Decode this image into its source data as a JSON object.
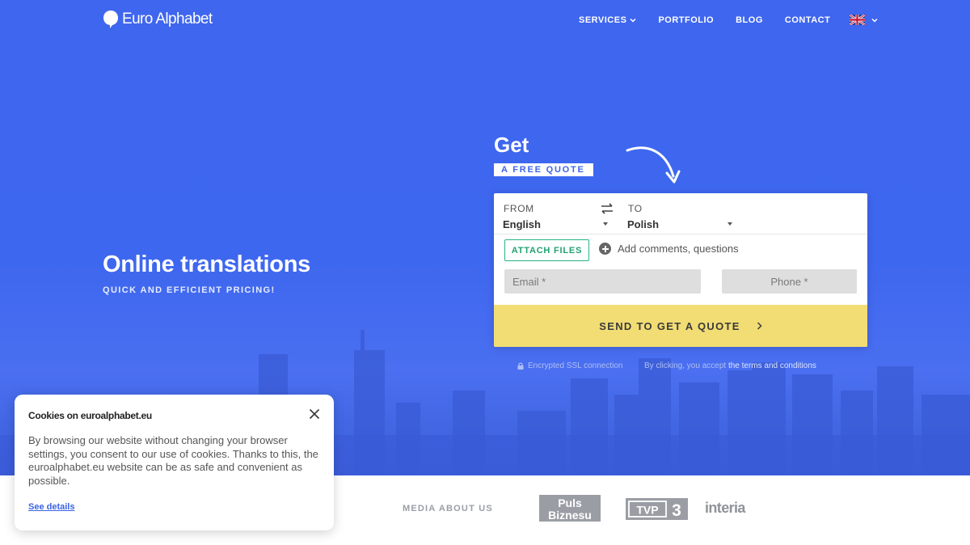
{
  "header": {
    "logo_text": "Euro Alphabet",
    "nav": [
      {
        "label": "SERVICES",
        "has_dropdown": true
      },
      {
        "label": "PORTFOLIO"
      },
      {
        "label": "BLOG"
      },
      {
        "label": "CONTACT"
      }
    ],
    "language_flag": "uk-flag-icon"
  },
  "hero": {
    "title": "Online translations",
    "subtitle": "QUICK AND EFFICIENT PRICING!"
  },
  "quote": {
    "get_label": "Get",
    "badge": "A FREE QUOTE",
    "from_label": "FROM",
    "from_value": "English",
    "to_label": "TO",
    "to_value": "Polish",
    "attach_label": "ATTACH FILES",
    "comments_label": "Add comments, questions",
    "email_placeholder": "Email *",
    "phone_placeholder": "Phone *",
    "send_label": "SEND TO GET A QUOTE",
    "ssl_text": "Encrypted SSL connection",
    "terms_prefix": "By clicking, you accept",
    "terms_link": "the terms and conditions"
  },
  "media": {
    "label": "MEDIA ABOUT US",
    "logos": [
      "Puls Biznesu",
      "TVP 3",
      "interia"
    ]
  },
  "cookie": {
    "title": "Cookies on euroalphabet.eu",
    "body": "By browsing our website without changing your browser settings, you consent to our use of cookies. Thanks to this, the euroalphabet.eu website can be as safe and convenient as possible.",
    "link": "See details"
  },
  "colors": {
    "hero_blue": "#3f66ee",
    "send_yellow": "#f2dd74",
    "attach_green": "#29b482",
    "link_blue": "#3b63e4"
  }
}
